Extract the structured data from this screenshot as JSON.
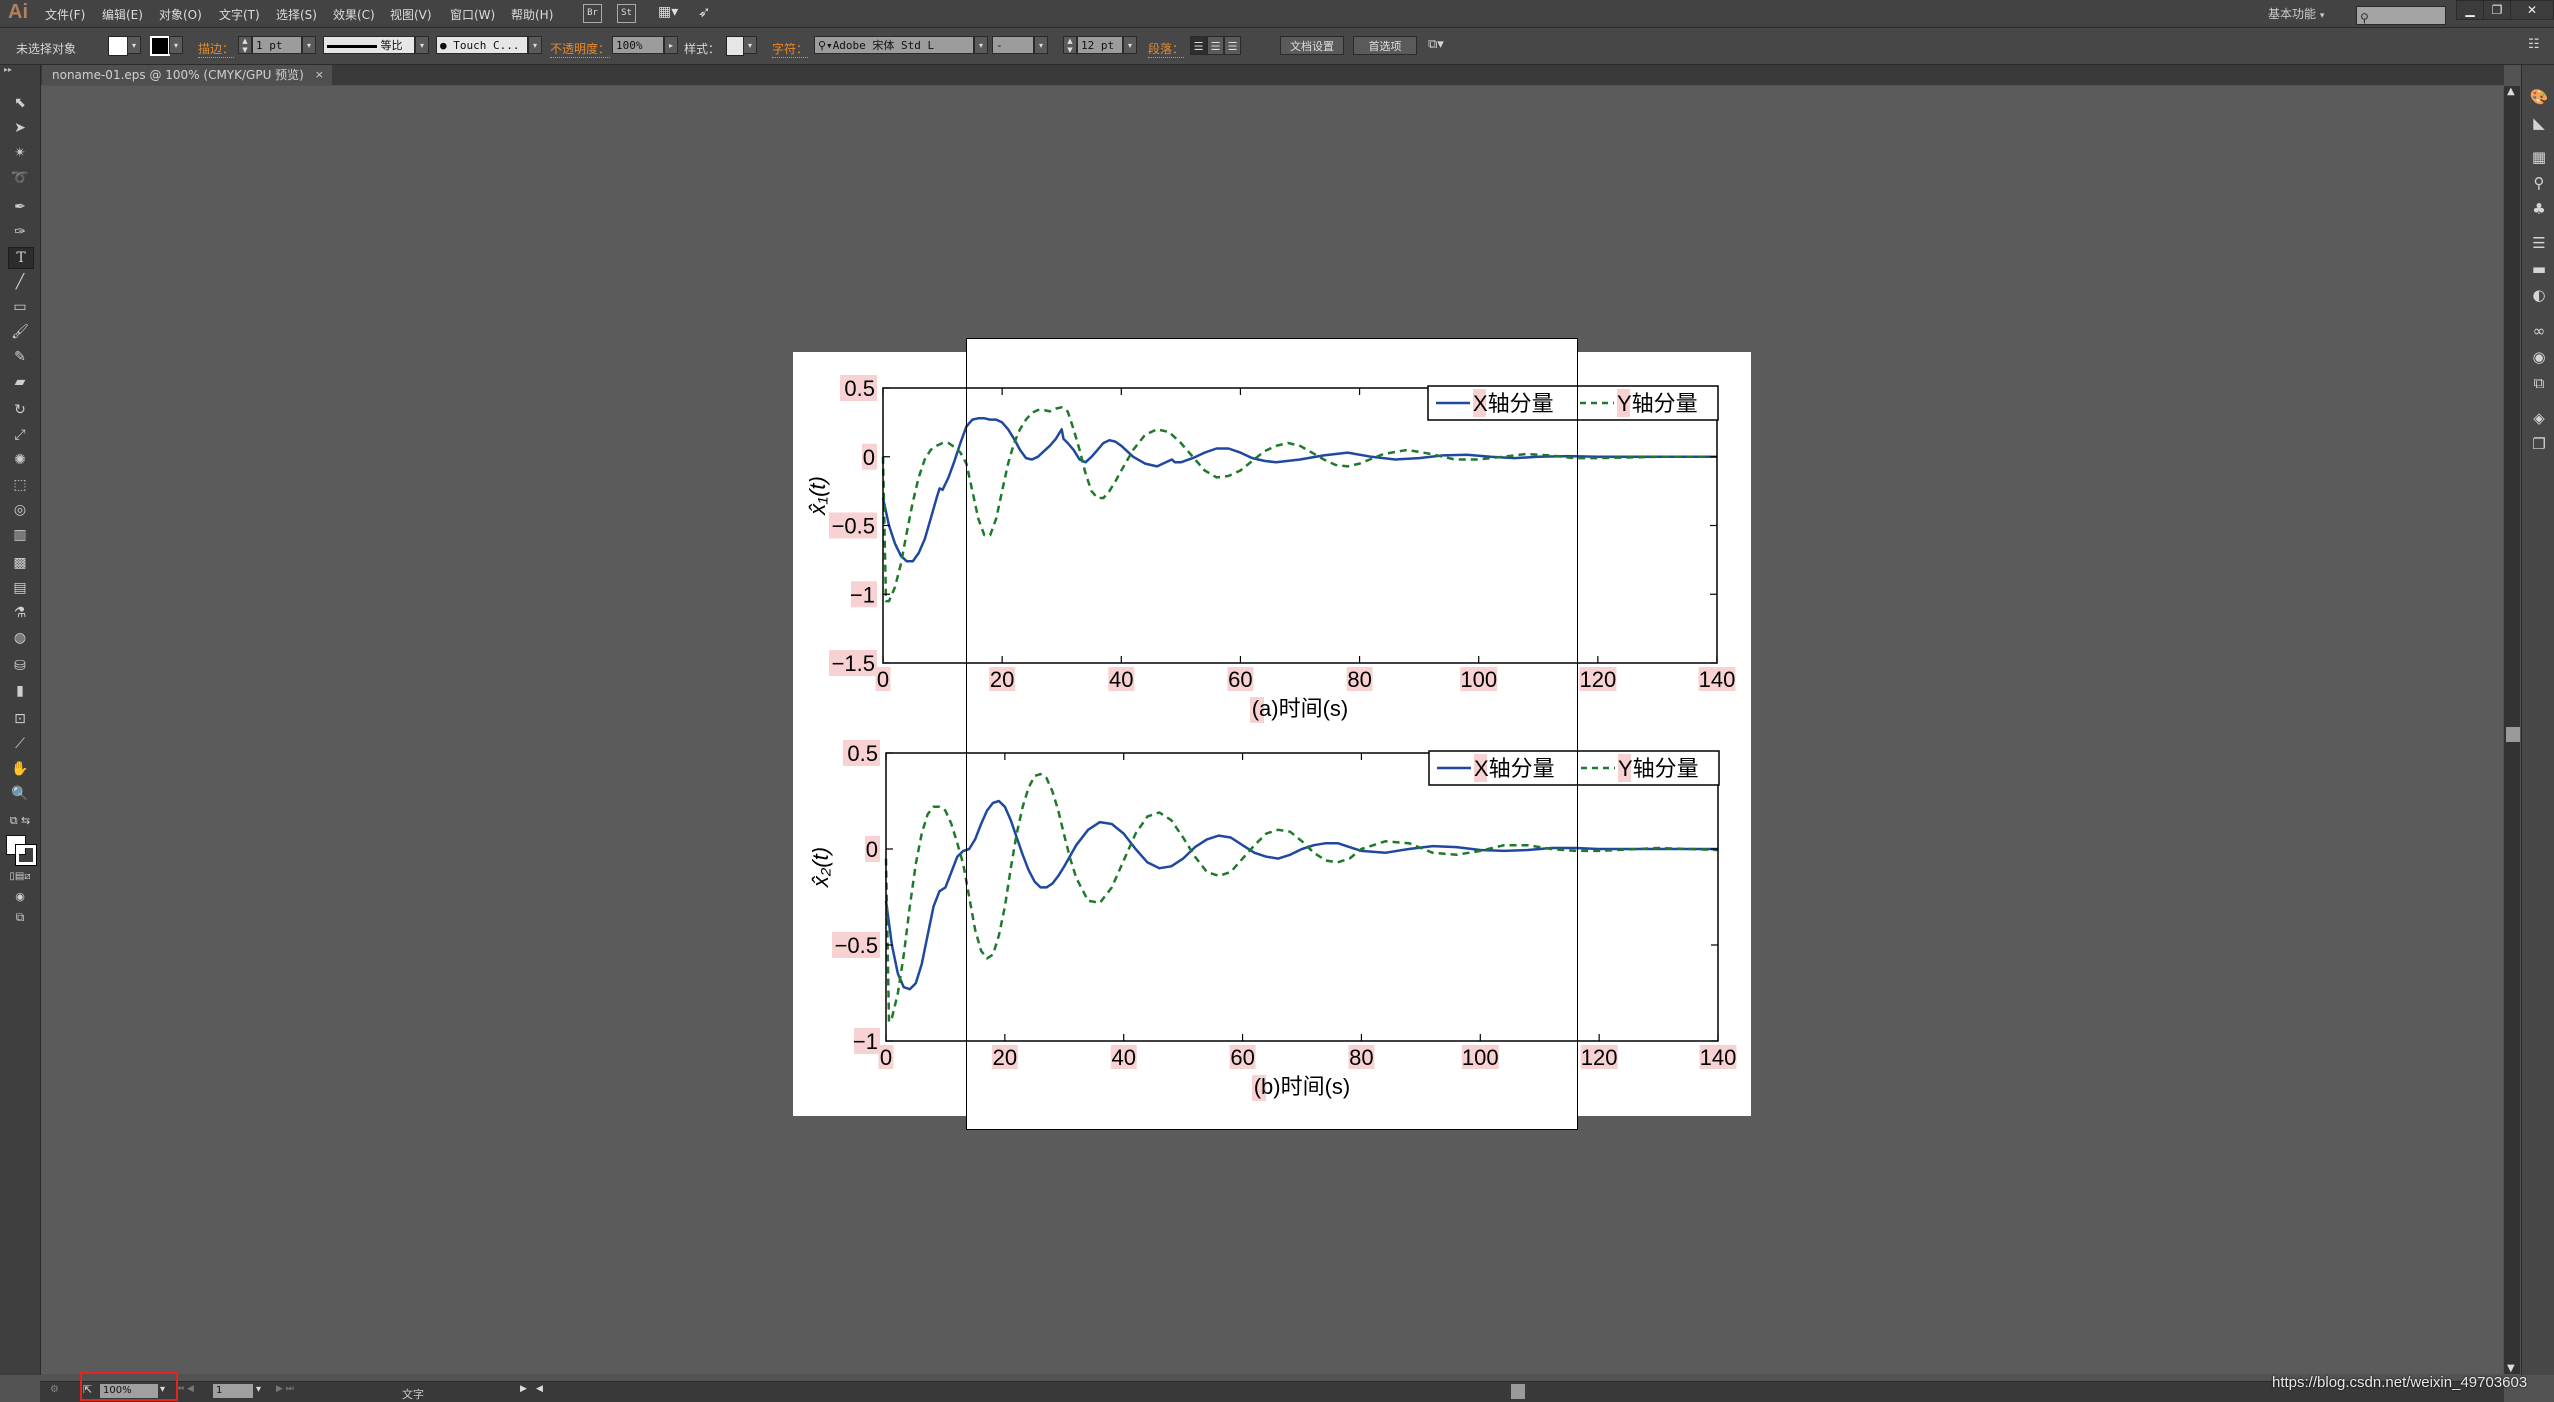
{
  "app": {
    "logo": "Ai",
    "menu": [
      "文件(F)",
      "编辑(E)",
      "对象(O)",
      "文字(T)",
      "选择(S)",
      "效果(C)",
      "视图(V)",
      "窗口(W)",
      "帮助(H)"
    ],
    "bridge_buttons": [
      "Br",
      "St"
    ],
    "arrange_icon": "arrange-documents-icon",
    "gpu_icon": "rocket-icon",
    "workspace": "基本功能",
    "window_controls": [
      "minimize",
      "restore",
      "close"
    ]
  },
  "control_bar": {
    "selection_status": "未选择对象",
    "stroke_label": "描边：",
    "stroke_weight": "1 pt",
    "stroke_profile": "等比",
    "brush": "Touch C...",
    "opacity_label": "不透明度：",
    "opacity": "100%",
    "style_label": "样式：",
    "character_label": "字符：",
    "font_family": "Adobe 宋体 Std L",
    "font_style": "-",
    "font_size": "12 pt",
    "paragraph_label": "段落：",
    "align_buttons": [
      "align-left",
      "align-center",
      "align-right"
    ],
    "document_setup": "文档设置",
    "preferences": "首选项"
  },
  "document_tab": {
    "title": "noname-01.eps @ 100% (CMYK/GPU 预览)",
    "close": "×"
  },
  "status_bar": {
    "zoom": "100%",
    "artboard": "1",
    "current_tool": "文字"
  },
  "watermark": "https://blog.csdn.net/weixin_49703603",
  "tools": [
    "selection",
    "direct-selection",
    "magic-wand",
    "lasso",
    "pen",
    "curvature",
    "type",
    "line-segment",
    "rectangle",
    "paintbrush",
    "pencil",
    "eraser",
    "rotate",
    "scale",
    "puppet-warp",
    "free-transform",
    "shape-builder",
    "perspective-grid",
    "mesh",
    "gradient",
    "eyedropper",
    "blend",
    "symbol-sprayer",
    "column-graph",
    "artboard",
    "slice",
    "hand",
    "zoom"
  ],
  "dock_panels": [
    "color",
    "color-guide",
    "swatches",
    "brushes",
    "symbols",
    "stroke",
    "gradient",
    "transparency",
    "cc-libraries",
    "appearance",
    "transform",
    "layers",
    "artboards"
  ],
  "chart_data": [
    {
      "type": "line",
      "title": "",
      "xlabel": "(a)时间(s)",
      "ylabel": "x̂₁(t)",
      "xlim": [
        0,
        140
      ],
      "ylim": [
        -1.5,
        0.5
      ],
      "xticks": [
        "0",
        "20",
        "40",
        "60",
        "80",
        "100",
        "120",
        "140"
      ],
      "yticks": [
        "0.5",
        "0",
        "−0.5",
        "−1",
        "−1.5"
      ],
      "ytick_values": [
        0.5,
        0,
        -0.5,
        -1,
        -1.5
      ],
      "xtick_values": [
        0,
        20,
        40,
        60,
        80,
        100,
        120,
        140
      ],
      "grid": false,
      "legend": "top-right",
      "series": [
        {
          "name": "X轴分量",
          "style": "solid",
          "color": "#1f48a0",
          "x": [
            0,
            1,
            2,
            3,
            4,
            5,
            6,
            7,
            8,
            9,
            9.5,
            10,
            11,
            12,
            13,
            14,
            15,
            16,
            17,
            18,
            19,
            20,
            21,
            22,
            23,
            24,
            25,
            26,
            27,
            28,
            29,
            30,
            30.3,
            31,
            32,
            33,
            34,
            35,
            36,
            37,
            38,
            39,
            40,
            42,
            44,
            46,
            47,
            48,
            48.5,
            49,
            50,
            52,
            54,
            56,
            58,
            60,
            62,
            64,
            66,
            68,
            70,
            74,
            78,
            82,
            86,
            90,
            94,
            98,
            102,
            106,
            110,
            115,
            120,
            130,
            140
          ],
          "y": [
            -0.3,
            -0.5,
            -0.63,
            -0.72,
            -0.76,
            -0.76,
            -0.7,
            -0.6,
            -0.45,
            -0.3,
            -0.23,
            -0.24,
            -0.15,
            -0.03,
            0.1,
            0.22,
            0.27,
            0.28,
            0.28,
            0.27,
            0.27,
            0.25,
            0.2,
            0.13,
            0.05,
            -0.01,
            -0.02,
            0.0,
            0.04,
            0.08,
            0.13,
            0.2,
            0.13,
            0.1,
            0.05,
            -0.02,
            -0.04,
            0.0,
            0.05,
            0.1,
            0.12,
            0.11,
            0.08,
            0.0,
            -0.05,
            -0.07,
            -0.05,
            -0.03,
            -0.02,
            -0.04,
            -0.04,
            -0.01,
            0.03,
            0.06,
            0.06,
            0.03,
            -0.01,
            -0.03,
            -0.04,
            -0.03,
            -0.02,
            0.01,
            0.03,
            0.0,
            -0.02,
            -0.01,
            0.01,
            0.015,
            0.0,
            -0.01,
            0.0,
            0.005,
            0.0,
            0.0,
            0.0
          ]
        },
        {
          "name": "Y轴分量",
          "style": "dashed",
          "color": "#1e7a2a",
          "x": [
            0,
            0.5,
            1,
            2,
            3,
            4,
            5,
            6,
            7,
            8,
            9,
            10,
            11,
            12,
            13,
            14,
            15,
            16,
            17,
            18,
            19,
            20,
            21,
            22,
            23,
            24,
            25,
            26,
            27,
            28,
            29,
            30,
            31,
            32,
            33,
            34,
            35,
            36,
            37,
            38,
            39,
            40,
            42,
            44,
            46,
            48,
            50,
            52,
            54,
            56,
            58,
            60,
            62,
            64,
            66,
            68,
            70,
            72,
            74,
            76,
            78,
            80,
            84,
            88,
            92,
            96,
            100,
            104,
            108,
            112,
            116,
            120,
            130,
            140
          ],
          "y": [
            0.0,
            -1.05,
            -1.05,
            -0.95,
            -0.78,
            -0.55,
            -0.33,
            -0.15,
            -0.02,
            0.05,
            0.08,
            0.1,
            0.1,
            0.07,
            0.03,
            -0.05,
            -0.25,
            -0.45,
            -0.57,
            -0.57,
            -0.45,
            -0.25,
            -0.05,
            0.1,
            0.2,
            0.27,
            0.32,
            0.34,
            0.34,
            0.33,
            0.35,
            0.36,
            0.33,
            0.2,
            0.05,
            -0.12,
            -0.25,
            -0.3,
            -0.3,
            -0.25,
            -0.18,
            -0.1,
            0.05,
            0.16,
            0.2,
            0.18,
            0.1,
            0.0,
            -0.1,
            -0.15,
            -0.14,
            -0.1,
            -0.03,
            0.04,
            0.08,
            0.1,
            0.08,
            0.03,
            -0.02,
            -0.06,
            -0.07,
            -0.05,
            0.02,
            0.05,
            0.02,
            -0.02,
            -0.02,
            0.0,
            0.02,
            0.01,
            -0.01,
            -0.01,
            0.0,
            0.0
          ]
        }
      ]
    },
    {
      "type": "line",
      "title": "",
      "xlabel": "(b)时间(s)",
      "ylabel": "x̂₂(t)",
      "xlim": [
        0,
        140
      ],
      "ylim": [
        -1,
        0.5
      ],
      "xticks": [
        "0",
        "20",
        "40",
        "60",
        "80",
        "100",
        "120",
        "140"
      ],
      "yticks": [
        "0.5",
        "0",
        "−0.5",
        "−1"
      ],
      "ytick_values": [
        0.5,
        0,
        -0.5,
        -1
      ],
      "xtick_values": [
        0,
        20,
        40,
        60,
        80,
        100,
        120,
        140
      ],
      "grid": false,
      "legend": "top-right",
      "series": [
        {
          "name": "X轴分量",
          "style": "solid",
          "color": "#1f48a0",
          "x": [
            0,
            1,
            2,
            3,
            4,
            5,
            6,
            7,
            8,
            9,
            9.5,
            10,
            11,
            12,
            13,
            14,
            15,
            16,
            17,
            18,
            19,
            20,
            21,
            22,
            23,
            24,
            25,
            26,
            27,
            28,
            29,
            30,
            32,
            34,
            36,
            38,
            40,
            42,
            44,
            46,
            48,
            50,
            52,
            54,
            56,
            58,
            60,
            62,
            64,
            66,
            68,
            70,
            72,
            74,
            76,
            78,
            80,
            84,
            88,
            92,
            96,
            100,
            104,
            108,
            112,
            116,
            120,
            130,
            140
          ],
          "y": [
            -0.27,
            -0.5,
            -0.65,
            -0.72,
            -0.73,
            -0.7,
            -0.6,
            -0.45,
            -0.3,
            -0.22,
            -0.21,
            -0.2,
            -0.12,
            -0.04,
            -0.01,
            0.0,
            0.05,
            0.13,
            0.2,
            0.24,
            0.25,
            0.22,
            0.15,
            0.06,
            -0.03,
            -0.11,
            -0.17,
            -0.2,
            -0.2,
            -0.18,
            -0.14,
            -0.09,
            0.02,
            0.1,
            0.14,
            0.13,
            0.08,
            0.0,
            -0.07,
            -0.1,
            -0.09,
            -0.05,
            0.01,
            0.05,
            0.07,
            0.06,
            0.02,
            -0.02,
            -0.04,
            -0.05,
            -0.03,
            0.0,
            0.02,
            0.03,
            0.03,
            0.01,
            -0.01,
            -0.02,
            0.0,
            0.015,
            0.01,
            -0.005,
            -0.01,
            -0.005,
            0.005,
            0.005,
            0.0,
            0.0,
            0.0
          ]
        },
        {
          "name": "Y轴分量",
          "style": "dashed",
          "color": "#1e7a2a",
          "x": [
            0,
            0.5,
            1,
            2,
            3,
            4,
            5,
            6,
            7,
            8,
            9,
            10,
            11,
            12,
            13,
            14,
            15,
            16,
            17,
            18,
            19,
            20,
            21,
            22,
            23,
            24,
            25,
            26,
            27,
            28,
            29,
            30,
            31,
            32,
            34,
            36,
            38,
            40,
            42,
            44,
            46,
            48,
            50,
            52,
            54,
            56,
            58,
            60,
            62,
            64,
            66,
            68,
            70,
            72,
            74,
            76,
            78,
            80,
            84,
            88,
            92,
            96,
            100,
            104,
            108,
            112,
            116,
            120,
            130,
            140
          ],
          "y": [
            -0.05,
            -0.9,
            -0.88,
            -0.75,
            -0.55,
            -0.3,
            -0.08,
            0.08,
            0.18,
            0.22,
            0.22,
            0.2,
            0.13,
            0.03,
            -0.08,
            -0.25,
            -0.42,
            -0.53,
            -0.57,
            -0.55,
            -0.45,
            -0.3,
            -0.1,
            0.08,
            0.22,
            0.32,
            0.38,
            0.39,
            0.37,
            0.3,
            0.2,
            0.07,
            -0.05,
            -0.15,
            -0.27,
            -0.28,
            -0.2,
            -0.06,
            0.08,
            0.17,
            0.19,
            0.15,
            0.06,
            -0.04,
            -0.12,
            -0.14,
            -0.12,
            -0.05,
            0.02,
            0.08,
            0.1,
            0.09,
            0.04,
            -0.02,
            -0.06,
            -0.07,
            -0.05,
            0.0,
            0.04,
            0.03,
            -0.02,
            -0.03,
            -0.01,
            0.02,
            0.02,
            0.0,
            -0.01,
            -0.01,
            0.005,
            -0.005
          ]
        }
      ]
    }
  ]
}
